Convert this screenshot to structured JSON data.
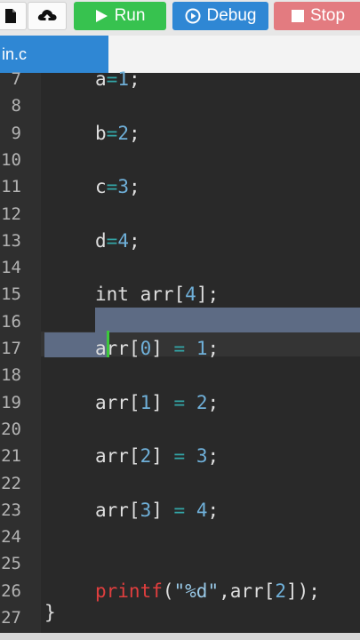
{
  "toolbar": {
    "run_label": "Run",
    "debug_label": "Debug",
    "stop_label": "Stop",
    "run_color": "#37c24f",
    "debug_color": "#2f87d4",
    "stop_color": "#e37b80",
    "icons": [
      "file-icon",
      "upload-icon",
      "play-icon",
      "debug-icon",
      "stop-icon"
    ]
  },
  "tab": {
    "label": "in.c",
    "active": true
  },
  "editor": {
    "lines": [
      {
        "num": "7",
        "tokens": [
          {
            "t": "a",
            "c": "id"
          },
          {
            "t": "=",
            "c": "op"
          },
          {
            "t": "1",
            "c": "num"
          },
          {
            "t": ";",
            "c": "id"
          }
        ]
      },
      {
        "num": "8",
        "tokens": []
      },
      {
        "num": "9",
        "tokens": [
          {
            "t": "b",
            "c": "id"
          },
          {
            "t": "=",
            "c": "op"
          },
          {
            "t": "2",
            "c": "num"
          },
          {
            "t": ";",
            "c": "id"
          }
        ]
      },
      {
        "num": "10",
        "tokens": []
      },
      {
        "num": "11",
        "tokens": [
          {
            "t": "c",
            "c": "id"
          },
          {
            "t": "=",
            "c": "op"
          },
          {
            "t": "3",
            "c": "num"
          },
          {
            "t": ";",
            "c": "id"
          }
        ]
      },
      {
        "num": "12",
        "tokens": []
      },
      {
        "num": "13",
        "tokens": [
          {
            "t": "d",
            "c": "id"
          },
          {
            "t": "=",
            "c": "op"
          },
          {
            "t": "4",
            "c": "num"
          },
          {
            "t": ";",
            "c": "id"
          }
        ]
      },
      {
        "num": "14",
        "tokens": []
      },
      {
        "num": "15",
        "tokens": [
          {
            "t": "int arr[",
            "c": "id"
          },
          {
            "t": "4",
            "c": "num"
          },
          {
            "t": "];",
            "c": "id"
          }
        ]
      },
      {
        "num": "16",
        "tokens": []
      },
      {
        "num": "17",
        "tokens": [
          {
            "t": "arr[",
            "c": "id"
          },
          {
            "t": "0",
            "c": "num"
          },
          {
            "t": "] ",
            "c": "id"
          },
          {
            "t": "=",
            "c": "op"
          },
          {
            "t": " ",
            "c": "id"
          },
          {
            "t": "1",
            "c": "num"
          },
          {
            "t": ";",
            "c": "id"
          }
        ]
      },
      {
        "num": "18",
        "tokens": []
      },
      {
        "num": "19",
        "tokens": [
          {
            "t": "arr[",
            "c": "id"
          },
          {
            "t": "1",
            "c": "num"
          },
          {
            "t": "] ",
            "c": "id"
          },
          {
            "t": "=",
            "c": "op"
          },
          {
            "t": " ",
            "c": "id"
          },
          {
            "t": "2",
            "c": "num"
          },
          {
            "t": ";",
            "c": "id"
          }
        ]
      },
      {
        "num": "20",
        "tokens": []
      },
      {
        "num": "21",
        "tokens": [
          {
            "t": "arr[",
            "c": "id"
          },
          {
            "t": "2",
            "c": "num"
          },
          {
            "t": "] ",
            "c": "id"
          },
          {
            "t": "=",
            "c": "op"
          },
          {
            "t": " ",
            "c": "id"
          },
          {
            "t": "3",
            "c": "num"
          },
          {
            "t": ";",
            "c": "id"
          }
        ]
      },
      {
        "num": "22",
        "tokens": []
      },
      {
        "num": "23",
        "tokens": [
          {
            "t": "arr[",
            "c": "id"
          },
          {
            "t": "3",
            "c": "num"
          },
          {
            "t": "] ",
            "c": "id"
          },
          {
            "t": "=",
            "c": "op"
          },
          {
            "t": " ",
            "c": "id"
          },
          {
            "t": "4",
            "c": "num"
          },
          {
            "t": ";",
            "c": "id"
          }
        ]
      },
      {
        "num": "24",
        "tokens": []
      },
      {
        "num": "25",
        "tokens": []
      },
      {
        "num": "26",
        "tokens": [
          {
            "t": "printf",
            "c": "fn"
          },
          {
            "t": "(",
            "c": "id"
          },
          {
            "t": "\"%d\"",
            "c": "str"
          },
          {
            "t": ",arr[",
            "c": "id"
          },
          {
            "t": "2",
            "c": "num"
          },
          {
            "t": "]);",
            "c": "id"
          }
        ]
      },
      {
        "num": "27",
        "tokens": []
      }
    ],
    "closing_brace": "}"
  }
}
